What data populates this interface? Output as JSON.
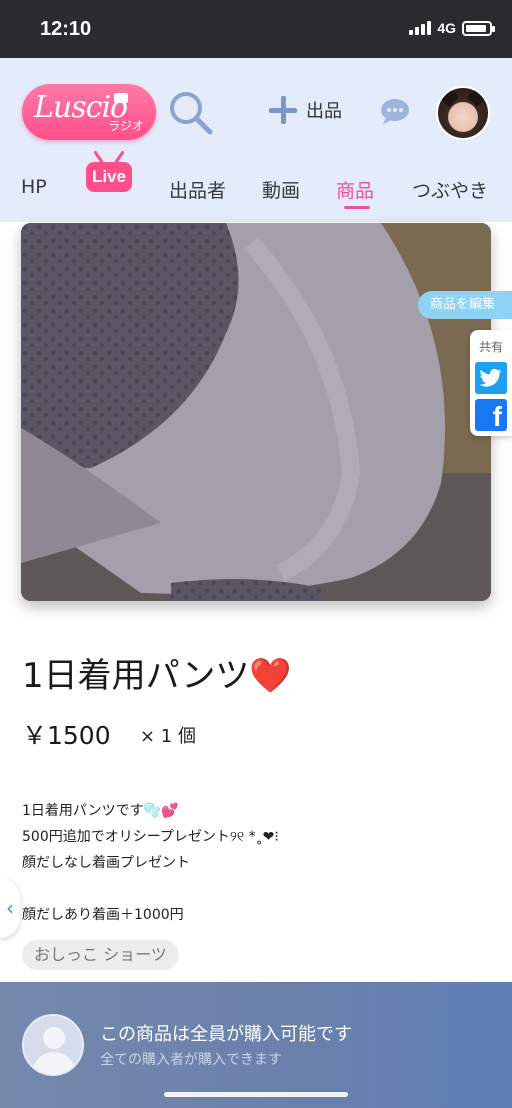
{
  "status_bar": {
    "time": "12:10",
    "network": "4G"
  },
  "header": {
    "logo_main": "Luscio",
    "logo_sub": "ラジオ",
    "add_label": "出品",
    "nav": [
      {
        "label": "HP",
        "active": false
      },
      {
        "label": "Live",
        "active": false
      },
      {
        "label": "出品者",
        "active": false
      },
      {
        "label": "動画",
        "active": false
      },
      {
        "label": "商品",
        "active": true
      },
      {
        "label": "つぶやき",
        "active": false
      }
    ]
  },
  "product": {
    "edit_label": "商品を編集",
    "share_label": "共有",
    "title": "1日着用パンツ❤️",
    "price": "￥1500",
    "quantity": "× 1 個",
    "description": [
      "1日着用パンツです🫧💕",
      "500円追加でオリシープレゼント୨୧ *˳❤︎⁝",
      "顔だしなし着画プレゼント",
      "",
      "顔だしあり着画＋1000円"
    ],
    "tag": "おしっこ ショーツ"
  },
  "purchase_bar": {
    "title": "この商品は全員が購入可能です",
    "subtitle": "全ての購入者が購入できます"
  },
  "colors": {
    "accent": "#f0509a",
    "header_bg": "#e4ecfb",
    "bar_bg": "#6980ab"
  }
}
